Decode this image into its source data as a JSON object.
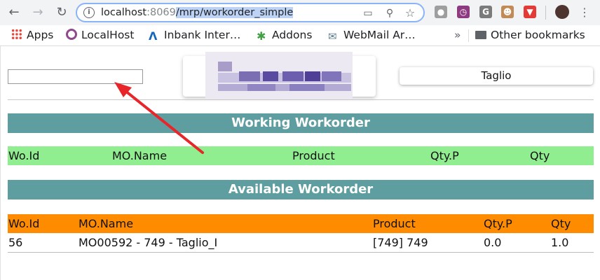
{
  "browser": {
    "url_host": "localhost",
    "url_port": ":8069",
    "url_path": "/mrp/workorder_simple",
    "bookmarks": [
      {
        "label": "Apps",
        "icon": "apps-grid-icon"
      },
      {
        "label": "LocalHost",
        "icon": "odoo-circle-icon"
      },
      {
        "label": "Inbank Inter…",
        "icon": "inbank-logo-icon"
      },
      {
        "label": "Addons",
        "icon": "puzzle-icon"
      },
      {
        "label": "WebMail Ar…",
        "icon": "webmail-icon"
      }
    ],
    "more_bookmarks": "»",
    "other_bookmarks": "Other bookmarks"
  },
  "page": {
    "scan_input_value": "",
    "workcenter_button": "Taglio",
    "working": {
      "title": "Working Workorder",
      "header_color": "#90ee90",
      "columns": [
        "Wo.Id",
        "MO.Name",
        "Product",
        "Qty.P",
        "Qty"
      ],
      "rows": []
    },
    "available": {
      "title": "Available Workorder",
      "header_color": "#ff8c00",
      "columns": [
        "Wo.Id",
        "MO.Name",
        "Product",
        "Qty.P",
        "Qty"
      ],
      "rows": [
        [
          "56",
          "MO00592 - 749 - Taglio_I",
          "[749] 749",
          "0.0",
          "1.0"
        ]
      ]
    },
    "section_color": "#5f9ea0",
    "annotation_arrow_color": "#e8262a"
  }
}
